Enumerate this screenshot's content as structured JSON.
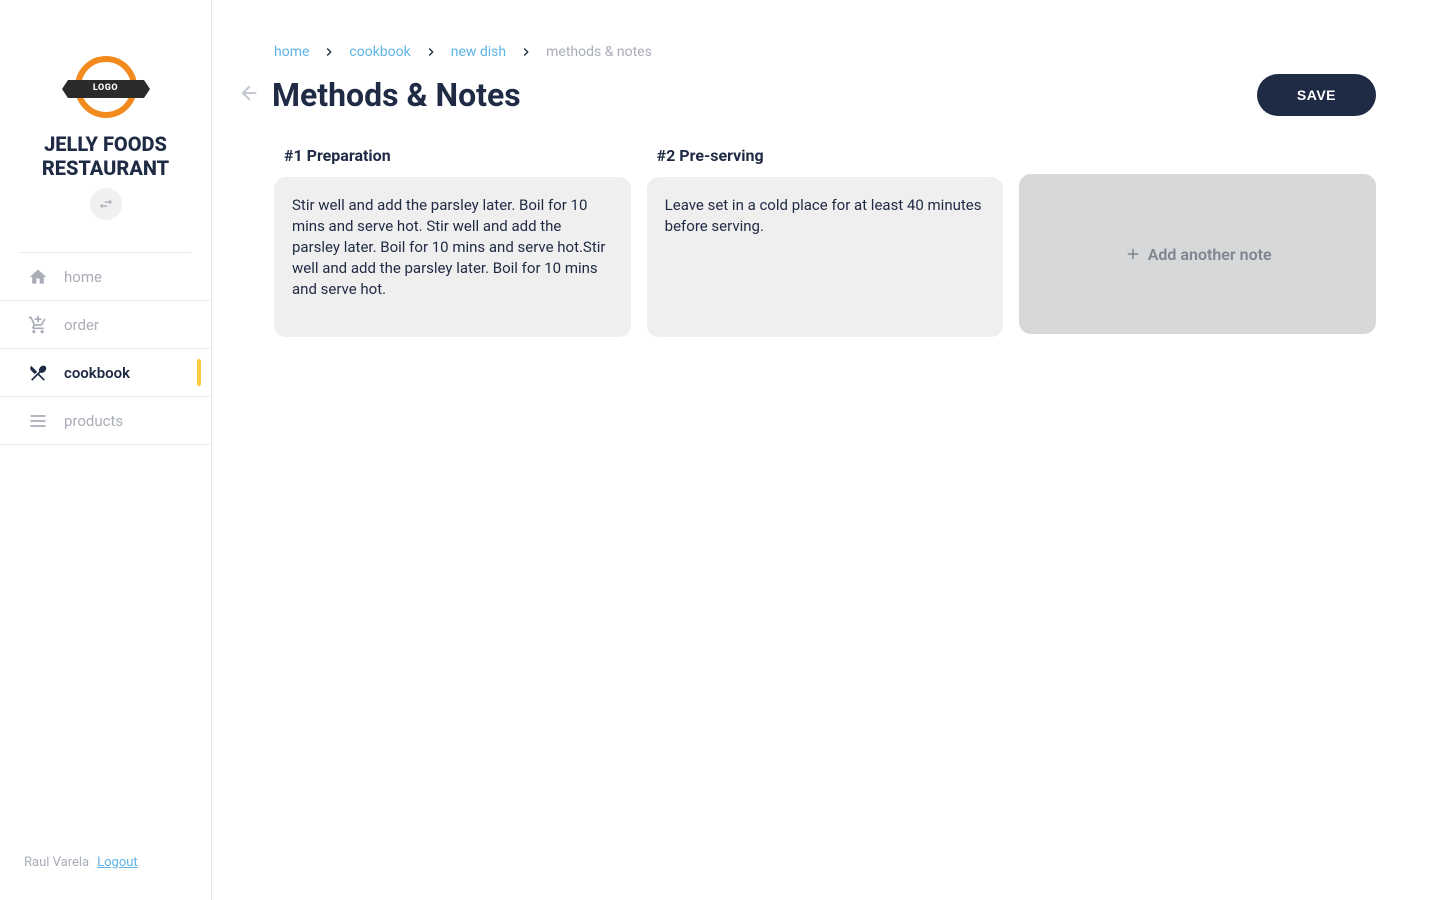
{
  "sidebar": {
    "brand_name_line1": "JELLY FOODS",
    "brand_name_line2": "RESTAURANT",
    "logo_text": "LOGO",
    "nav": [
      {
        "label": "home",
        "icon": "home-icon",
        "active": false
      },
      {
        "label": "order",
        "icon": "order-icon",
        "active": false
      },
      {
        "label": "cookbook",
        "icon": "cookbook-icon",
        "active": true
      },
      {
        "label": "products",
        "icon": "products-icon",
        "active": false
      }
    ],
    "user_name": "Raul Varela",
    "logout_label": "Logout"
  },
  "breadcrumb": [
    {
      "label": "home",
      "active": false
    },
    {
      "label": "cookbook",
      "active": false
    },
    {
      "label": "new dish",
      "active": false
    },
    {
      "label": "methods & notes",
      "active": true
    }
  ],
  "page_title": "Methods & Notes",
  "save_button": "SAVE",
  "notes": [
    {
      "title": "#1 Preparation",
      "body": "Stir well and add the parsley later. Boil for 10 mins and serve hot. Stir well and add the parsley later. Boil for 10 mins and serve hot.Stir well and add the parsley later. Boil for 10 mins and serve hot."
    },
    {
      "title": "#2 Pre-serving",
      "body": "Leave set in a cold place for at least 40 minutes before serving."
    }
  ],
  "add_note_label": "Add another note"
}
